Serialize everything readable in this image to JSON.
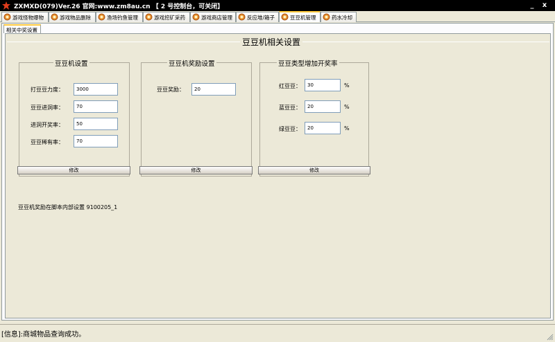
{
  "window": {
    "title": "ZXMXD(079)Ver.26 官网:www.zm8au.cn 【 2 号控制台，可关闭】",
    "minimize_label": "_",
    "close_label": "x"
  },
  "tabs": [
    {
      "label": "游戏怪物爆物"
    },
    {
      "label": "游戏物品删除"
    },
    {
      "label": "渔场钓鱼管理"
    },
    {
      "label": "游戏挖矿采药"
    },
    {
      "label": "游戏商店管理"
    },
    {
      "label": "反应堆/箱子"
    },
    {
      "label": "豆豆机管理",
      "active": true
    },
    {
      "label": "药水冷却"
    }
  ],
  "subtab": {
    "label": "相关中奖设置"
  },
  "main": {
    "title": "豆豆机相关设置",
    "groups": {
      "machine": {
        "title": "豆豆机设置",
        "fields": [
          {
            "label": "打豆豆力度：",
            "value": "3000"
          },
          {
            "label": "豆豆进洞率：",
            "value": "70"
          },
          {
            "label": "进洞开奖率：",
            "value": "50"
          },
          {
            "label": "豆豆稀有率：",
            "value": "70"
          }
        ],
        "button": "修改"
      },
      "reward": {
        "title": "豆豆机奖励设置",
        "fields": [
          {
            "label": "豆豆奖励：",
            "value": "20"
          }
        ],
        "button": "修改"
      },
      "types": {
        "title": "豆豆类型增加开奖率",
        "fields": [
          {
            "label": "红豆豆：",
            "value": "30",
            "unit": "%"
          },
          {
            "label": "蓝豆豆：",
            "value": "20",
            "unit": "%"
          },
          {
            "label": "绿豆豆：",
            "value": "20",
            "unit": "%"
          }
        ],
        "button": "修改"
      }
    },
    "note": "豆豆机奖励在脚本内部设置 9100205_1"
  },
  "status": {
    "text": "[信息]:商城物品查询成功。"
  },
  "colors": {
    "titlebar": "#000000",
    "tab_active_border": "#ffc83c",
    "panel": "#ece9d8",
    "input_border": "#7f9db9"
  }
}
